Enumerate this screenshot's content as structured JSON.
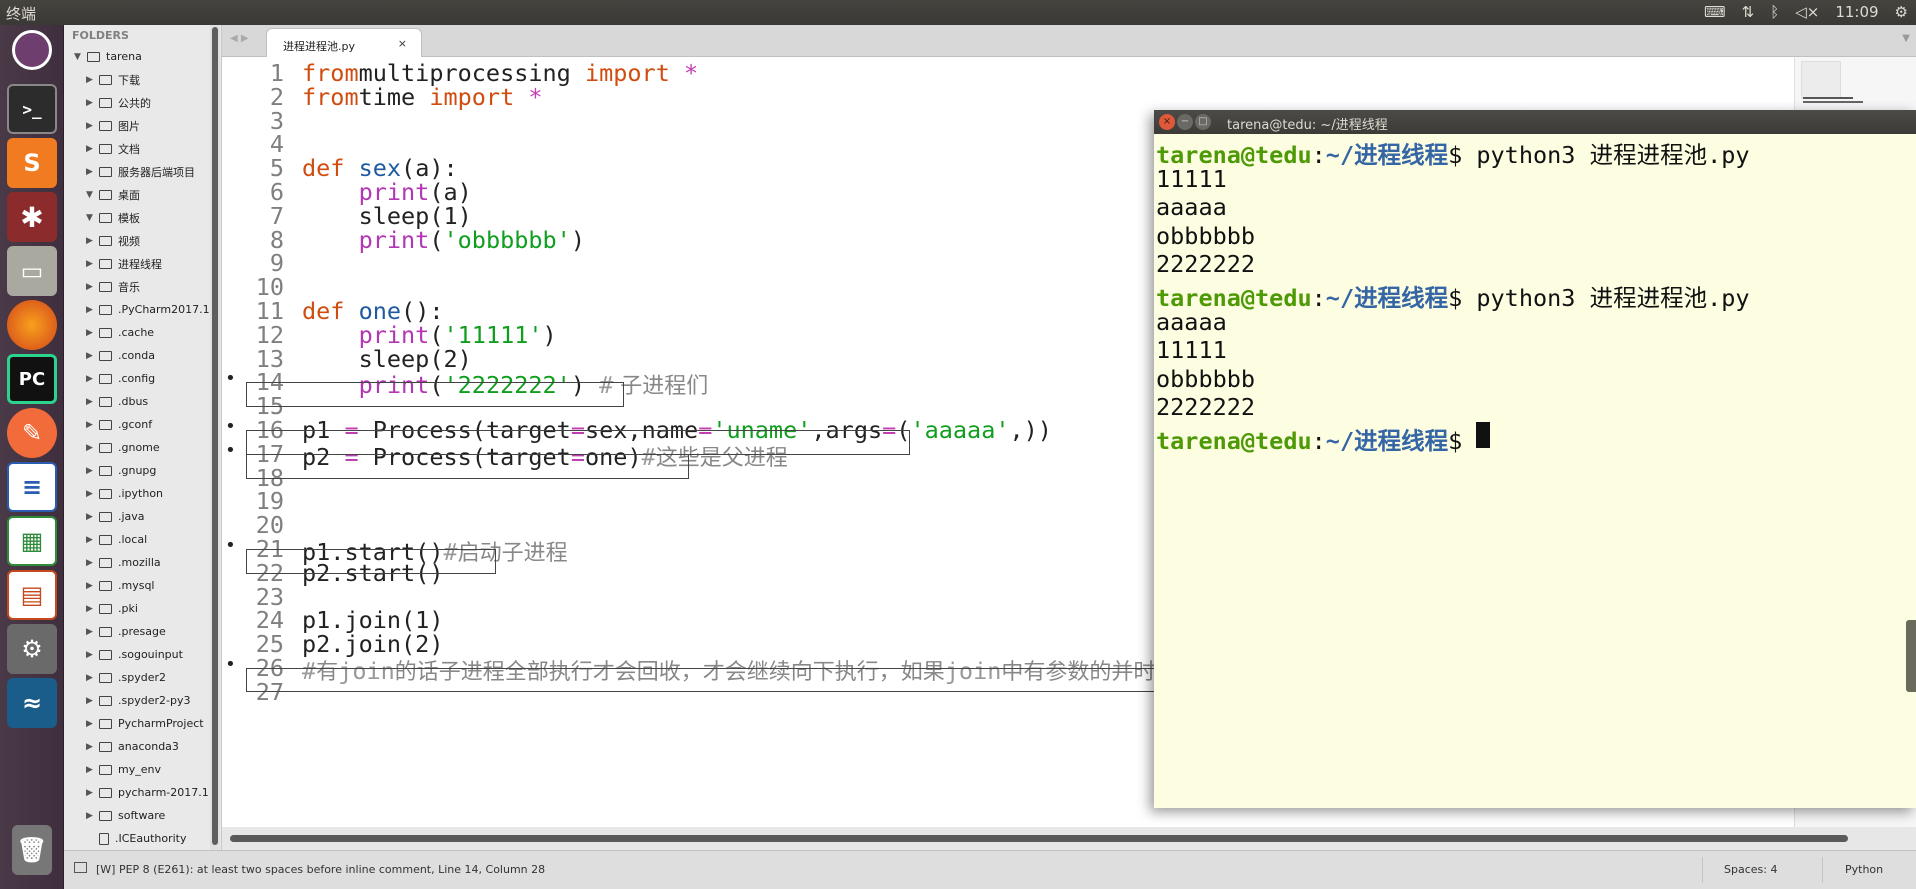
{
  "topbar": {
    "title": "终端",
    "clock": "11:09",
    "tray_icons": [
      "keyboard-icon",
      "network-icon",
      "bluetooth-icon",
      "volume-icon",
      "clock",
      "settings-gear-icon"
    ]
  },
  "launcher": {
    "items": [
      "ubuntu-logo-icon",
      "terminal-icon",
      "sublime-text-icon",
      "network-app-icon",
      "files-icon",
      "firefox-icon",
      "pycharm-icon",
      "postman-icon",
      "writer-icon",
      "calc-icon",
      "impress-icon",
      "system-settings-icon",
      "mysql-workbench-icon",
      "trash-icon"
    ],
    "pycharm_label": "PC",
    "sublime_label": "S"
  },
  "sidebar": {
    "header": "FOLDERS",
    "root": "tarena",
    "items": [
      {
        "label": "下载",
        "arrow": "▶"
      },
      {
        "label": "公共的",
        "arrow": "▶"
      },
      {
        "label": "图片",
        "arrow": "▶"
      },
      {
        "label": "文档",
        "arrow": "▶"
      },
      {
        "label": "服务器后端项目",
        "arrow": "▶"
      },
      {
        "label": "桌面",
        "arrow": "▼"
      },
      {
        "label": "模板",
        "arrow": "▼"
      },
      {
        "label": "视频",
        "arrow": "▶"
      },
      {
        "label": "进程线程",
        "arrow": "▶"
      },
      {
        "label": "音乐",
        "arrow": "▶"
      },
      {
        "label": ".PyCharm2017.1",
        "arrow": "▶"
      },
      {
        "label": ".cache",
        "arrow": "▶"
      },
      {
        "label": ".conda",
        "arrow": "▶"
      },
      {
        "label": ".config",
        "arrow": "▶"
      },
      {
        "label": ".dbus",
        "arrow": "▶"
      },
      {
        "label": ".gconf",
        "arrow": "▶"
      },
      {
        "label": ".gnome",
        "arrow": "▶"
      },
      {
        "label": ".gnupg",
        "arrow": "▶"
      },
      {
        "label": ".ipython",
        "arrow": "▶"
      },
      {
        "label": ".java",
        "arrow": "▶"
      },
      {
        "label": ".local",
        "arrow": "▶"
      },
      {
        "label": ".mozilla",
        "arrow": "▶"
      },
      {
        "label": ".mysql",
        "arrow": "▶"
      },
      {
        "label": ".pki",
        "arrow": "▶"
      },
      {
        "label": ".presage",
        "arrow": "▶"
      },
      {
        "label": ".sogouinput",
        "arrow": "▶"
      },
      {
        "label": ".spyder2",
        "arrow": "▶"
      },
      {
        "label": ".spyder2-py3",
        "arrow": "▶"
      },
      {
        "label": "PycharmProject",
        "arrow": "▶"
      },
      {
        "label": "anaconda3",
        "arrow": "▶"
      },
      {
        "label": "my_env",
        "arrow": "▶"
      },
      {
        "label": "pycharm-2017.1",
        "arrow": "▶"
      },
      {
        "label": "software",
        "arrow": "▶"
      },
      {
        "label": ".ICEauthority",
        "arrow": ""
      }
    ]
  },
  "editor": {
    "tab_label": "进程进程池.py",
    "tab_close": "×",
    "lines": [
      {
        "n": "1",
        "tokens": [
          [
            "kw",
            "from"
          ],
          [
            "",
            "multiprocessing "
          ],
          [
            "kw",
            "import"
          ],
          [
            "op",
            " *"
          ]
        ]
      },
      {
        "n": "2",
        "tokens": [
          [
            "kw",
            "from"
          ],
          [
            "",
            "time "
          ],
          [
            "kw",
            "import"
          ],
          [
            "op",
            " *"
          ]
        ]
      },
      {
        "n": "3",
        "tokens": []
      },
      {
        "n": "4",
        "tokens": []
      },
      {
        "n": "5",
        "tokens": [
          [
            "kw",
            "def"
          ],
          [
            "",
            ""
          ],
          [
            "fn",
            " sex"
          ],
          [
            "",
            "(a):"
          ]
        ]
      },
      {
        "n": "6",
        "tokens": [
          [
            "",
            "    "
          ],
          [
            "bi",
            "print"
          ],
          [
            "",
            "(a)"
          ]
        ]
      },
      {
        "n": "7",
        "tokens": [
          [
            "",
            "    sleep(1)"
          ]
        ]
      },
      {
        "n": "8",
        "tokens": [
          [
            "",
            "    "
          ],
          [
            "bi",
            "print"
          ],
          [
            "",
            "("
          ],
          [
            "str",
            "'obbbbbb'"
          ],
          [
            "",
            ")"
          ]
        ]
      },
      {
        "n": "9",
        "tokens": []
      },
      {
        "n": "10",
        "tokens": []
      },
      {
        "n": "11",
        "tokens": [
          [
            "kw",
            "def"
          ],
          [
            "fn",
            " one"
          ],
          [
            "",
            "():"
          ]
        ]
      },
      {
        "n": "12",
        "tokens": [
          [
            "",
            "    "
          ],
          [
            "bi",
            "print"
          ],
          [
            "",
            "("
          ],
          [
            "str",
            "'11111'"
          ],
          [
            "",
            ")"
          ]
        ]
      },
      {
        "n": "13",
        "tokens": [
          [
            "",
            "    sleep(2)"
          ]
        ]
      },
      {
        "n": "14",
        "bullet": true,
        "tokens": [
          [
            "",
            "    "
          ],
          [
            "bi",
            "print"
          ],
          [
            "",
            "("
          ],
          [
            "str",
            "'2222222'"
          ],
          [
            "",
            ")"
          ],
          [
            "cm",
            " #"
          ],
          [
            "cmzh",
            " 子进程们"
          ]
        ]
      },
      {
        "n": "15",
        "tokens": []
      },
      {
        "n": "16",
        "bullet": true,
        "tokens": [
          [
            "",
            "p1 "
          ],
          [
            "op",
            "="
          ],
          [
            "",
            " Process(target"
          ],
          [
            "op",
            "="
          ],
          [
            "",
            "sex,name"
          ],
          [
            "op",
            "="
          ],
          [
            "str",
            "'uname'"
          ],
          [
            "",
            ",args"
          ],
          [
            "op",
            "="
          ],
          [
            "",
            "("
          ],
          [
            "str",
            "'aaaaa'"
          ],
          [
            "",
            ",))"
          ]
        ]
      },
      {
        "n": "17",
        "bullet": true,
        "tokens": [
          [
            "",
            "p2 "
          ],
          [
            "op",
            "="
          ],
          [
            "",
            " Process(target"
          ],
          [
            "op",
            "="
          ],
          [
            "",
            "one)"
          ],
          [
            "cm",
            "#"
          ],
          [
            "cmzh",
            "这些是父进程"
          ]
        ]
      },
      {
        "n": "18",
        "tokens": []
      },
      {
        "n": "19",
        "tokens": []
      },
      {
        "n": "20",
        "tokens": []
      },
      {
        "n": "21",
        "bullet": true,
        "tokens": [
          [
            "",
            "p1.start()"
          ],
          [
            "cm",
            "#"
          ],
          [
            "cmzh",
            "启动子进程"
          ]
        ]
      },
      {
        "n": "22",
        "tokens": [
          [
            "",
            "p2.start()"
          ]
        ]
      },
      {
        "n": "23",
        "tokens": []
      },
      {
        "n": "24",
        "tokens": [
          [
            "",
            "p1.join(1)"
          ]
        ]
      },
      {
        "n": "25",
        "tokens": [
          [
            "",
            "p2.join(2)"
          ]
        ]
      },
      {
        "n": "26",
        "bullet": true,
        "tokens": [
          [
            "cm",
            "#"
          ],
          [
            "cmzh",
            "有"
          ],
          [
            "cm",
            "join"
          ],
          [
            "cmzh",
            "的话子进程全部执行才会回收，才会继续向下执行，如果"
          ],
          [
            "cm",
            "join"
          ],
          [
            "cmzh",
            "中有参数的并时结束后，进程将会变为孤儿进程"
          ]
        ]
      },
      {
        "n": "27",
        "tokens": []
      }
    ]
  },
  "terminal": {
    "title": "tarena@tedu: ~/进程线程",
    "prompt_user": "tarena@tedu",
    "prompt_path": "~/进程线程",
    "lines": [
      {
        "prompt": true,
        "text": "$ python3 进程进程池.py"
      },
      {
        "prompt": false,
        "text": "11111"
      },
      {
        "prompt": false,
        "text": "aaaaa"
      },
      {
        "prompt": false,
        "text": "obbbbbb"
      },
      {
        "prompt": false,
        "text": "2222222"
      },
      {
        "prompt": true,
        "text": "$ python3 进程进程池.py"
      },
      {
        "prompt": false,
        "text": "aaaaa"
      },
      {
        "prompt": false,
        "text": "11111"
      },
      {
        "prompt": false,
        "text": "obbbbbb"
      },
      {
        "prompt": false,
        "text": "2222222"
      },
      {
        "prompt": true,
        "text": "$ ",
        "cursor": true
      }
    ]
  },
  "statusbar": {
    "message": "[W] PEP 8 (E261): at least two spaces before inline comment, Line 14, Column 28",
    "spaces": "Spaces: 4",
    "language": "Python"
  }
}
